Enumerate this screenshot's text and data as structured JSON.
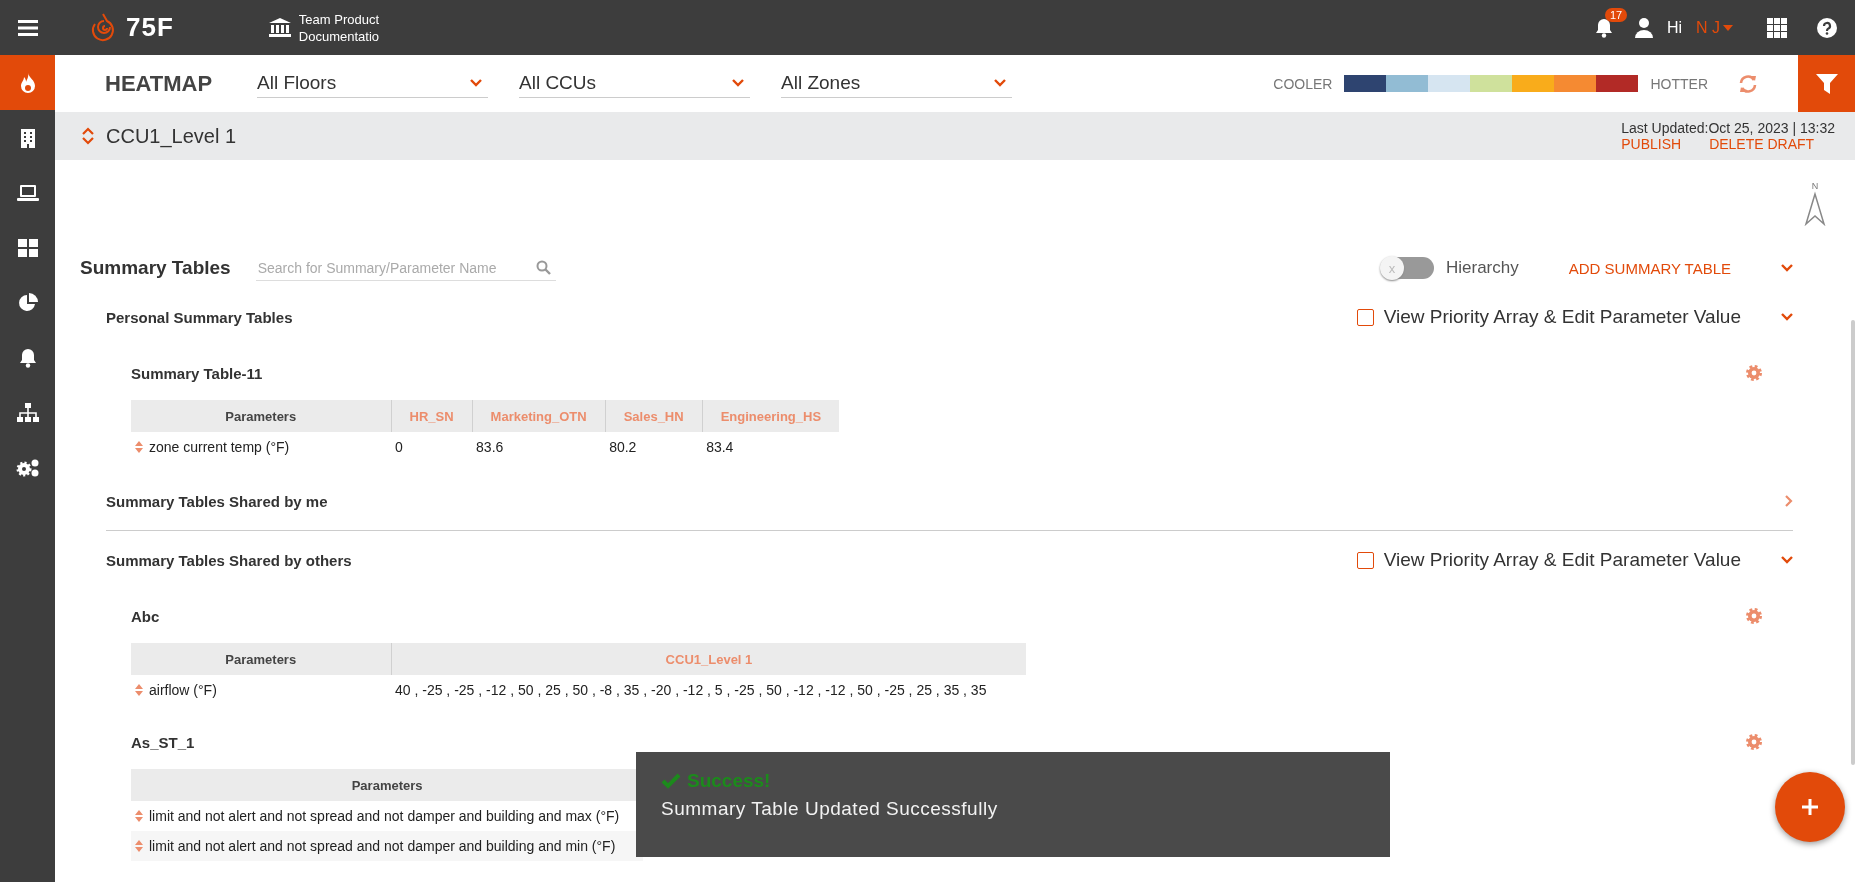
{
  "topbar": {
    "brand": "75F",
    "site_lines": [
      "Team Product",
      "Documentatio"
    ],
    "notifications": "17",
    "greeting": "Hi",
    "user": "N J"
  },
  "sidebar": {
    "items": [
      {
        "kind": "flame",
        "selected": true
      },
      {
        "kind": "building",
        "selected": false
      },
      {
        "kind": "laptop",
        "selected": false
      },
      {
        "kind": "grid",
        "selected": false
      },
      {
        "kind": "pie",
        "selected": false
      },
      {
        "kind": "bell",
        "selected": false
      },
      {
        "kind": "sitemap",
        "selected": false
      },
      {
        "kind": "gears",
        "selected": false
      }
    ]
  },
  "filters": {
    "title": "HEATMAP",
    "dropdowns": [
      "All Floors",
      "All CCUs",
      "All Zones"
    ],
    "legend": {
      "cooler": "COOLER",
      "hotter": "HOTTER",
      "swatches": [
        {
          "color": "#2e4470"
        },
        {
          "color": "#92bcd4"
        },
        {
          "color": "#d6e5f1"
        },
        {
          "color": "#cfe19c"
        },
        {
          "color": "#f9ac1b"
        },
        {
          "color": "#f58a32"
        },
        {
          "color": "#b22a26"
        }
      ]
    }
  },
  "compass": {
    "label": "N"
  },
  "ccu_bar": {
    "name": "CCU1_Level 1",
    "last_updated": "Last Updated:Oct 25, 2023 | 13:32",
    "actions": [
      "PUBLISH",
      "DELETE DRAFT"
    ]
  },
  "summary": {
    "title": "Summary Tables",
    "search_placeholder": "Search for Summary/Parameter Name",
    "hierarchy": {
      "label": "Hierarchy",
      "on": false,
      "knob": "x"
    },
    "add_label": "ADD SUMMARY TABLE",
    "sections": [
      {
        "title": "Personal Summary Tables",
        "expanded": true,
        "priority": {
          "label": "View Priority Array & Edit Parameter Value",
          "checked": false
        },
        "tables": [
          {
            "title": "Summary Table-11",
            "columns": [
              "Parameters",
              "HR_SN",
              "Marketing_OTN",
              "Sales_HN",
              "Engineering_HS"
            ],
            "rows": [
              {
                "param": "zone current temp  (°F)",
                "values": [
                  "0",
                  "83.6",
                  "80.2",
                  "83.4"
                ]
              }
            ]
          }
        ]
      },
      {
        "title": "Summary Tables Shared by me",
        "expanded": false
      },
      {
        "title": "Summary Tables Shared by others",
        "expanded": true,
        "priority": {
          "label": "View Priority Array & Edit Parameter Value",
          "checked": false
        },
        "tables": [
          {
            "title": "Abc",
            "columns": [
              "Parameters",
              "CCU1_Level 1"
            ],
            "rows": [
              {
                "param": "airflow  (°F)",
                "values": [
                  "40 , -25 , -25 , -12 , 50 , 25 , 50 , -8 , 35 , -20 , -12 , 5 , -25 , 50 , -12 , -12 , 50 , -25 , 25 , 35 , 35"
                ]
              }
            ]
          },
          {
            "title": "As_ST_1",
            "columns": [
              "Parameters"
            ],
            "rows": [
              {
                "param": "limit and not alert and not spread and not damper and building and max  (°F)",
                "values": []
              },
              {
                "param": "limit and not alert and not spread and not damper and building and min  (°F)",
                "values": []
              }
            ]
          }
        ]
      }
    ]
  },
  "toast": {
    "title": "Success!",
    "message": "Summary Table Updated Successfully"
  }
}
